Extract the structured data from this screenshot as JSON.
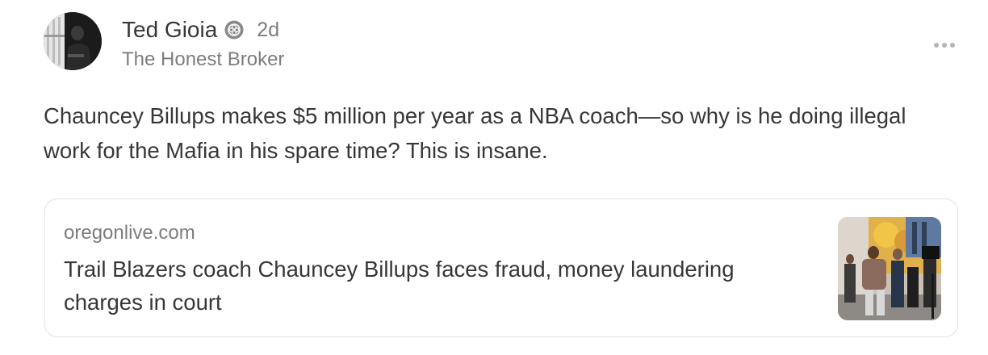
{
  "author": {
    "name": "Ted Gioia",
    "time": "2d",
    "publication": "The Honest Broker"
  },
  "note": {
    "text": "Chauncey Billups makes $5 million per year as a NBA coach—so why is he doing illegal work for the Mafia in his spare time? This is insane."
  },
  "link_card": {
    "domain": "oregonlive.com",
    "title": "Trail Blazers coach Chauncey Billups faces fraud, money laundering charges in court"
  },
  "icons": {
    "verified": "verified-badge-icon",
    "more": "more-options-icon"
  },
  "colors": {
    "text": "#363737",
    "muted": "#7d7d7d",
    "border": "#e3e3e3"
  }
}
